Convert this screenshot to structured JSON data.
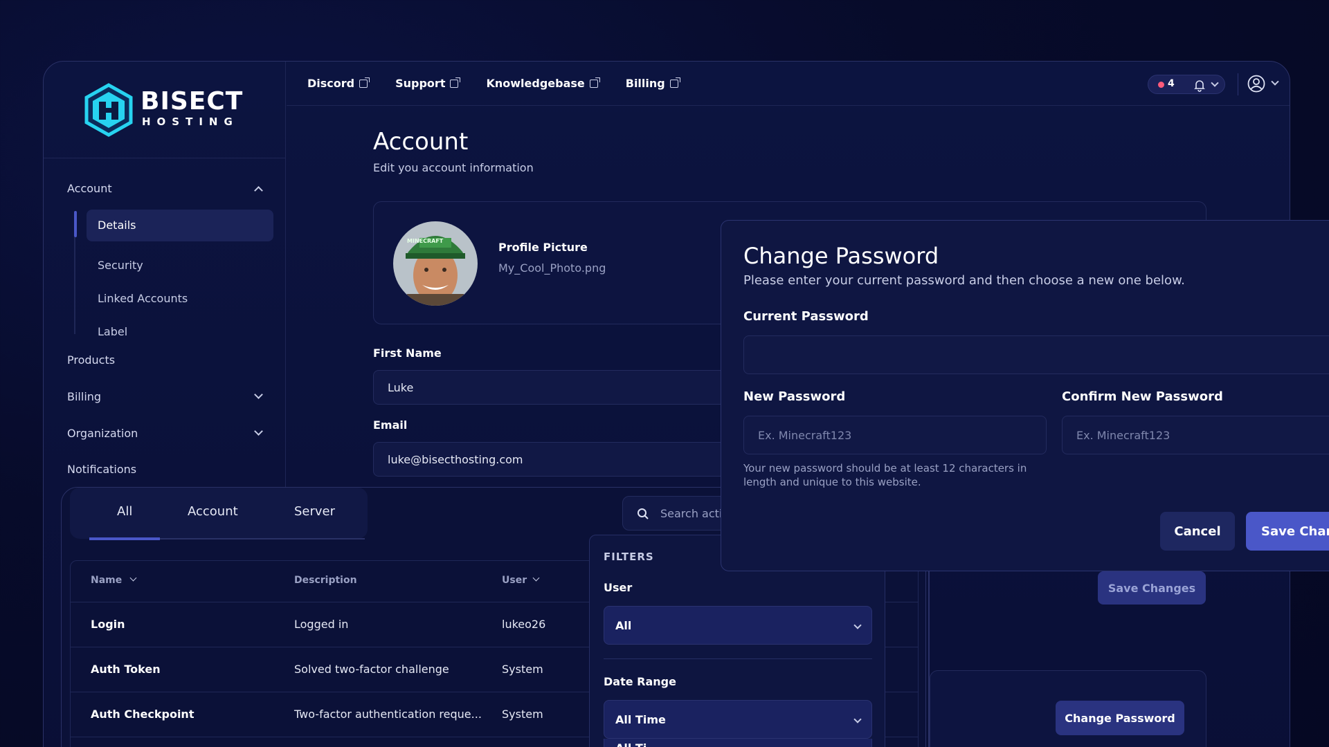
{
  "brand": {
    "line1": "BISECT",
    "line2": "HOSTING"
  },
  "topnav": [
    {
      "label": "Discord"
    },
    {
      "label": "Support"
    },
    {
      "label": "Knowledgebase"
    },
    {
      "label": "Billing"
    }
  ],
  "notifications": {
    "count": "4"
  },
  "sidebar": {
    "account": "Account",
    "account_items": [
      "Details",
      "Security",
      "Linked Accounts",
      "Label"
    ],
    "products": "Products",
    "billing": "Billing",
    "organization": "Organization",
    "notifications": "Notifications"
  },
  "page": {
    "title": "Account",
    "subtitle": "Edit you account information"
  },
  "profile": {
    "label": "Profile Picture",
    "filename": "My_Cool_Photo.png",
    "hat_text": "MINECRAFT"
  },
  "form": {
    "first_name_label": "First Name",
    "first_name_value": "Luke",
    "email_label": "Email",
    "email_value": "luke@bisecthosting.com",
    "save_changes": "Save Changes",
    "change_password": "Change Password"
  },
  "modal": {
    "title": "Change Password",
    "subtitle": "Please enter your current password and then choose a new one below.",
    "current_label": "Current Password",
    "new_label": "New Password",
    "confirm_label": "Confirm New Password",
    "new_placeholder": "Ex. Minecraft123",
    "confirm_placeholder": "Ex. Minecraft123",
    "hint": "Your new password should be at least 12 characters in length and unique to this website.",
    "cancel": "Cancel",
    "save": "Save Chang"
  },
  "activity": {
    "tabs": [
      "All",
      "Account",
      "Server"
    ],
    "search_placeholder": "Search acti",
    "columns": {
      "name": "Name",
      "description": "Description",
      "user": "User"
    },
    "rows": [
      {
        "name": "Login",
        "description": "Logged in",
        "user": "lukeo26"
      },
      {
        "name": "Auth Token",
        "description": "Solved two-factor challenge",
        "user": "System"
      },
      {
        "name": "Auth Checkpoint",
        "description": "Two-factor authentication reque...",
        "user": "System"
      }
    ]
  },
  "filters": {
    "title": "FILTERS",
    "user_label": "User",
    "user_value": "All",
    "date_label": "Date Range",
    "date_value": "All Time",
    "date_option_partial": "All Ti"
  },
  "colors": {
    "accent": "#4a57c8",
    "background": "#070b2a",
    "notif_dot": "#ff5a7a",
    "logo_cyan": "#27d3f0"
  }
}
